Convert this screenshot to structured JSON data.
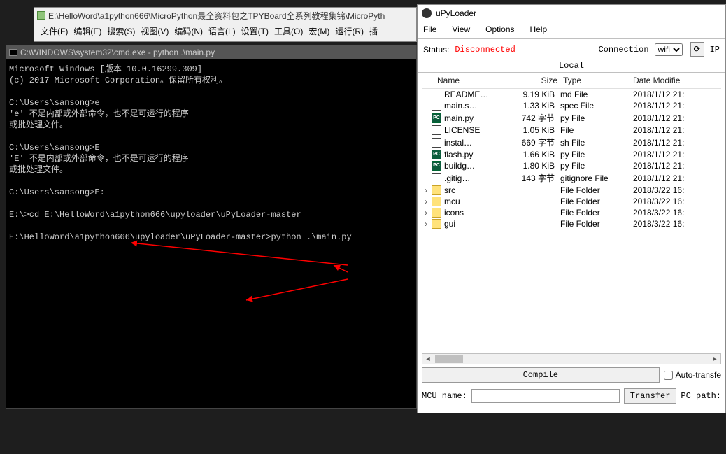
{
  "editor": {
    "title": "E:\\HelloWord\\a1python666\\MicroPython最全资料包之TPYBoard全系列教程集锦\\MicroPyth",
    "menu": [
      "文件(F)",
      "编辑(E)",
      "搜索(S)",
      "视图(V)",
      "编码(N)",
      "语言(L)",
      "设置(T)",
      "工具(O)",
      "宏(M)",
      "运行(R)",
      "插"
    ]
  },
  "cmd": {
    "title": "C:\\WINDOWS\\system32\\cmd.exe - python .\\main.py",
    "body": "Microsoft Windows [版本 10.0.16299.309]\n(c) 2017 Microsoft Corporation。保留所有权利。\n\nC:\\Users\\sansong>e\n'e' 不是内部或外部命令，也不是可运行的程序\n或批处理文件。\n\nC:\\Users\\sansong>E\n'E' 不是内部或外部命令，也不是可运行的程序\n或批处理文件。\n\nC:\\Users\\sansong>E:\n\nE:\\>cd E:\\HelloWord\\a1python666\\upyloader\\uPyLoader-master\n\nE:\\HelloWord\\a1python666\\upyloader\\uPyLoader-master>python .\\main.py"
  },
  "upy": {
    "title": "uPyLoader",
    "menu": [
      "File",
      "View",
      "Options",
      "Help"
    ],
    "status_label": "Status:",
    "status_value": "Disconnected",
    "connection_label": "Connection",
    "connection_value": "wifi",
    "ip_label": "IP",
    "local_label": "Local",
    "columns": {
      "name": "Name",
      "size": "Size",
      "type": "Type",
      "date": "Date Modifie"
    },
    "files": [
      {
        "icon": "doc",
        "name": "README…",
        "size": "9.19 KiB",
        "type": "md File",
        "date": "2018/1/12 21:"
      },
      {
        "icon": "doc",
        "name": "main.s…",
        "size": "1.33 KiB",
        "type": "spec File",
        "date": "2018/1/12 21:"
      },
      {
        "icon": "pc",
        "name": "main.py",
        "size": "742 字节",
        "type": "py File",
        "date": "2018/1/12 21:"
      },
      {
        "icon": "doc",
        "name": "LICENSE",
        "size": "1.05 KiB",
        "type": "File",
        "date": "2018/1/12 21:"
      },
      {
        "icon": "doc",
        "name": "instal…",
        "size": "669 字节",
        "type": "sh File",
        "date": "2018/1/12 21:"
      },
      {
        "icon": "pc",
        "name": "flash.py",
        "size": "1.66 KiB",
        "type": "py File",
        "date": "2018/1/12 21:"
      },
      {
        "icon": "pc",
        "name": "buildg…",
        "size": "1.80 KiB",
        "type": "py File",
        "date": "2018/1/12 21:"
      },
      {
        "icon": "doc",
        "name": ".gitig…",
        "size": "143 字节",
        "type": "gitignore File",
        "date": "2018/1/12 21:"
      },
      {
        "icon": "fold",
        "arrow": "›",
        "name": "src",
        "size": "",
        "type": "File Folder",
        "date": "2018/3/22 16:"
      },
      {
        "icon": "fold",
        "arrow": "›",
        "name": "mcu",
        "size": "",
        "type": "File Folder",
        "date": "2018/3/22 16:"
      },
      {
        "icon": "fold",
        "arrow": "›",
        "name": "icons",
        "size": "",
        "type": "File Folder",
        "date": "2018/3/22 16:"
      },
      {
        "icon": "fold",
        "arrow": "›",
        "name": "gui",
        "size": "",
        "type": "File Folder",
        "date": "2018/3/22 16:"
      }
    ],
    "compile_btn": "Compile",
    "auto_transfer": "Auto-transfe",
    "mcu_name_label": "MCU name:",
    "transfer_btn": "Transfer",
    "pc_label": "PC path:"
  }
}
